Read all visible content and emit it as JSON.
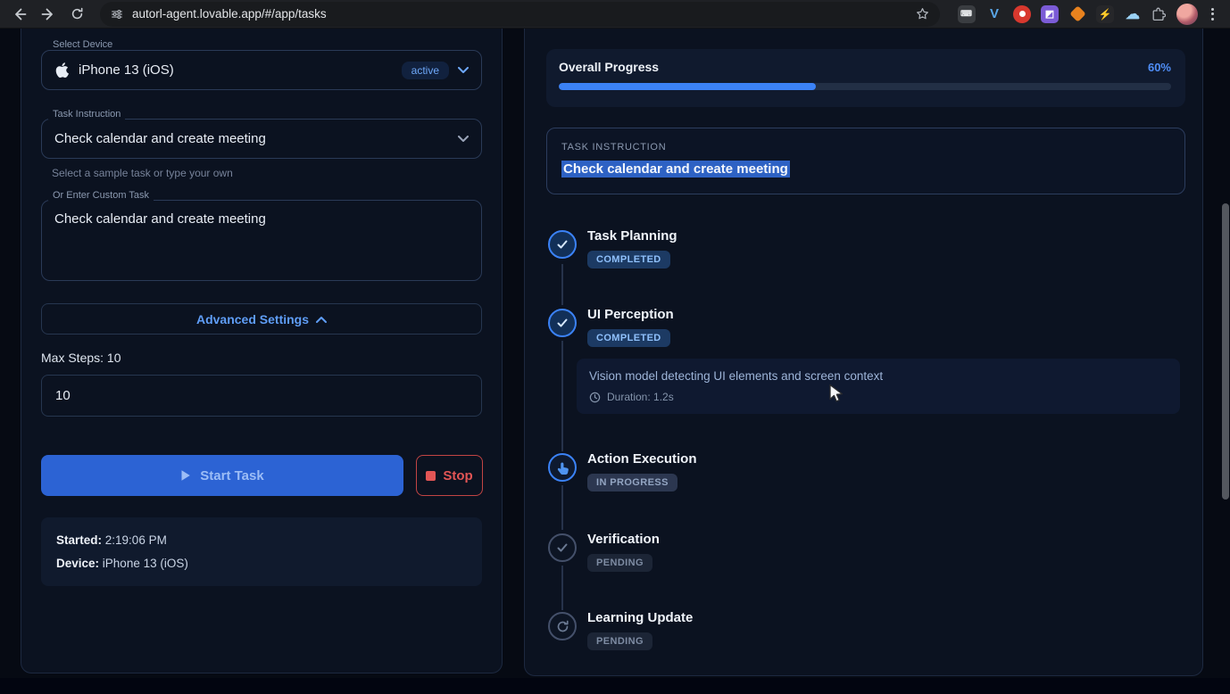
{
  "browser": {
    "url": "autorl-agent.lovable.app/#/app/tasks"
  },
  "left_panel": {
    "device_label": "Select Device",
    "device_value": "iPhone 13 (iOS)",
    "device_badge": "active",
    "task_label": "Task Instruction",
    "task_value": "Check calendar and create meeting",
    "task_helper": "Select a sample task or type your own",
    "custom_label": "Or Enter Custom Task",
    "custom_value": "Check calendar and create meeting",
    "advanced_label": "Advanced Settings",
    "max_steps_label": "Max Steps: 10",
    "max_steps_value": "10",
    "start_label": "Start Task",
    "stop_label": "Stop",
    "status": {
      "started_label": "Started:",
      "started_value": "2:19:06 PM",
      "device_label": "Device:",
      "device_value": "iPhone 13 (iOS)"
    }
  },
  "right_panel": {
    "progress_label": "Overall Progress",
    "progress_percent": "60%",
    "progress_fill_percent": 42,
    "instruction_label": "TASK INSTRUCTION",
    "instruction_value": "Check calendar and create meeting",
    "steps": [
      {
        "title": "Task Planning",
        "status": "COMPLETED"
      },
      {
        "title": "UI Perception",
        "status": "COMPLETED",
        "detail": "Vision model detecting UI elements and screen context",
        "duration": "Duration: 1.2s"
      },
      {
        "title": "Action Execution",
        "status": "IN PROGRESS"
      },
      {
        "title": "Verification",
        "status": "PENDING"
      },
      {
        "title": "Learning Update",
        "status": "PENDING"
      }
    ]
  },
  "colors": {
    "accent": "#3b82f6",
    "accent_light": "#60a5fa",
    "danger": "#e25555",
    "completed_badge_text": "#8fc0fb",
    "pending_text": "#7e8ca3",
    "selection_highlight": "#2e62c4"
  }
}
